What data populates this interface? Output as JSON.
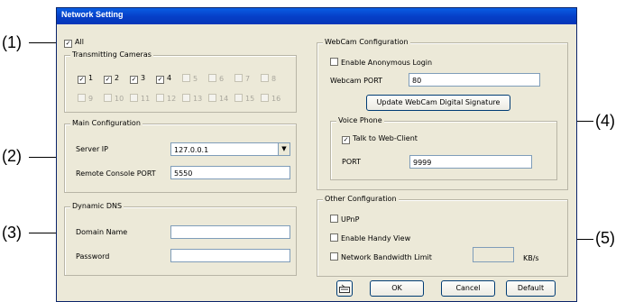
{
  "callouts": [
    "(1)",
    "(2)",
    "(3)",
    "(4)",
    "(5)"
  ],
  "window": {
    "title": "Network Setting"
  },
  "all_checkbox": {
    "label": "All",
    "checked": true
  },
  "transmitting": {
    "title": "Transmitting Cameras",
    "cameras": [
      {
        "label": "1",
        "checked": true,
        "enabled": true
      },
      {
        "label": "2",
        "checked": true,
        "enabled": true
      },
      {
        "label": "3",
        "checked": true,
        "enabled": true
      },
      {
        "label": "4",
        "checked": true,
        "enabled": true
      },
      {
        "label": "5",
        "checked": false,
        "enabled": false
      },
      {
        "label": "6",
        "checked": false,
        "enabled": false
      },
      {
        "label": "7",
        "checked": false,
        "enabled": false
      },
      {
        "label": "8",
        "checked": false,
        "enabled": false
      },
      {
        "label": "9",
        "checked": false,
        "enabled": false
      },
      {
        "label": "10",
        "checked": false,
        "enabled": false
      },
      {
        "label": "11",
        "checked": false,
        "enabled": false
      },
      {
        "label": "12",
        "checked": false,
        "enabled": false
      },
      {
        "label": "13",
        "checked": false,
        "enabled": false
      },
      {
        "label": "14",
        "checked": false,
        "enabled": false
      },
      {
        "label": "15",
        "checked": false,
        "enabled": false
      },
      {
        "label": "16",
        "checked": false,
        "enabled": false
      }
    ]
  },
  "main": {
    "title": "Main Configuration",
    "server_ip_label": "Server IP",
    "server_ip_value": "127.0.0.1",
    "console_port_label": "Remote Console PORT",
    "console_port_value": "5550"
  },
  "ddns": {
    "title": "Dynamic DNS",
    "domain_label": "Domain Name",
    "domain_value": "",
    "password_label": "Password",
    "password_value": ""
  },
  "webcam": {
    "title": "WebCam Configuration",
    "anon_label": "Enable Anonymous Login",
    "anon_checked": false,
    "port_label": "Webcam PORT",
    "port_value": "80",
    "update_button": "Update WebCam Digital Signature",
    "voice": {
      "title": "Voice Phone",
      "talk_label": "Talk to Web-Client",
      "talk_checked": true,
      "port_label": "PORT",
      "port_value": "9999"
    }
  },
  "other": {
    "title": "Other Configuration",
    "upnp_label": "UPnP",
    "upnp_checked": false,
    "handy_label": "Enable Handy View",
    "handy_checked": false,
    "bandwidth_label": "Network Bandwidth Limit",
    "bandwidth_checked": false,
    "bandwidth_value": "",
    "bandwidth_unit": "KB/s"
  },
  "buttons": {
    "ok": "OK",
    "cancel": "Cancel",
    "default": "Default",
    "keyboard_icon": "keyboard-icon"
  },
  "colors": {
    "title_bar": "#0a5ee4",
    "dialog_bg": "#ece9d8"
  }
}
